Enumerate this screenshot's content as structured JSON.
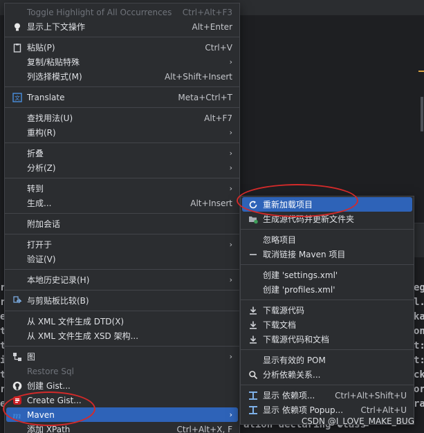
{
  "main_menu": {
    "items": [
      {
        "label": "Toggle Highlight of All Occurrences",
        "shortcut": "Ctrl+Alt+F3",
        "icon": "none",
        "disabled": true
      },
      {
        "label": "显示上下文操作",
        "shortcut": "Alt+Enter",
        "icon": "bulb-icon"
      },
      {
        "sep": true
      },
      {
        "label": "粘贴(P)",
        "shortcut": "Ctrl+V",
        "icon": "clipboard-icon"
      },
      {
        "label": "复制/粘贴特殊",
        "submenu": true
      },
      {
        "label": "列选择模式(M)",
        "shortcut": "Alt+Shift+Insert"
      },
      {
        "sep": true
      },
      {
        "label": "Translate",
        "shortcut": "Meta+Ctrl+T",
        "icon": "translate-icon"
      },
      {
        "sep": true
      },
      {
        "label": "查找用法(U)",
        "shortcut": "Alt+F7"
      },
      {
        "label": "重构(R)",
        "submenu": true
      },
      {
        "sep": true
      },
      {
        "label": "折叠",
        "submenu": true
      },
      {
        "label": "分析(Z)",
        "submenu": true
      },
      {
        "sep": true
      },
      {
        "label": "转到",
        "submenu": true
      },
      {
        "label": "生成...",
        "shortcut": "Alt+Insert"
      },
      {
        "sep": true
      },
      {
        "label": "附加会话"
      },
      {
        "sep": true
      },
      {
        "label": "打开于",
        "submenu": true
      },
      {
        "label": "验证(V)"
      },
      {
        "sep": true
      },
      {
        "label": "本地历史记录(H)",
        "submenu": true
      },
      {
        "sep": true
      },
      {
        "label": "与剪贴板比较(B)",
        "icon": "compare-icon"
      },
      {
        "sep": true
      },
      {
        "label": "从 XML 文件生成 DTD(X)"
      },
      {
        "label": "从 XML 文件生成 XSD 架构..."
      },
      {
        "sep": true
      },
      {
        "label": "图",
        "submenu": true,
        "icon": "diagram-icon"
      },
      {
        "label": "Restore Sql",
        "disabled": true
      },
      {
        "label": "创建 Gist...",
        "icon": "github-icon"
      },
      {
        "label": "Create Gist...",
        "icon": "gitee-icon"
      },
      {
        "label": "Maven",
        "submenu": true,
        "icon": "maven-icon",
        "selected": true
      },
      {
        "label": "添加 XPath",
        "shortcut": "Ctrl+Alt+X, F"
      }
    ]
  },
  "maven_menu": {
    "items": [
      {
        "label": "重新加载项目",
        "icon": "reload-icon",
        "selected": true
      },
      {
        "label": "生成源代码并更新文件夹",
        "icon": "folder-refresh-icon"
      },
      {
        "sep": true
      },
      {
        "label": "忽略项目"
      },
      {
        "label": "取消链接 Maven 项目",
        "icon": "minus-icon"
      },
      {
        "sep": true
      },
      {
        "label": "创建 'settings.xml'"
      },
      {
        "label": "创建 'profiles.xml'"
      },
      {
        "sep": true
      },
      {
        "label": "下载源代码",
        "icon": "download-icon"
      },
      {
        "label": "下载文档",
        "icon": "download-icon"
      },
      {
        "label": "下载源代码和文档",
        "icon": "download-icon"
      },
      {
        "sep": true
      },
      {
        "label": "显示有效的 POM"
      },
      {
        "label": "分析依赖关系...",
        "icon": "search-icon"
      },
      {
        "sep": true
      },
      {
        "label": "显示 依赖项...",
        "shortcut": "Ctrl+Alt+Shift+U",
        "icon": "dependency-icon"
      },
      {
        "label": "显示 依赖项 Popup...",
        "shortcut": "Ctrl+Alt+U",
        "icon": "dependency-icon"
      }
    ]
  },
  "background_code": {
    "line1": "ation declaring class",
    "right_fragments": [
      "eg",
      "l.",
      "ka",
      "on",
      "t:",
      "t:",
      "ck",
      "or",
      "ra"
    ],
    "left_fragments": [
      "r",
      "r",
      "e",
      "t",
      "t",
      "i",
      "t",
      "r",
      "e"
    ]
  },
  "watermark": "CSDN @I_LOVE_MAKE_BUG",
  "colors": {
    "menu_bg": "#2b2d30",
    "selection": "#2e63b8",
    "annotation": "#d42a2a"
  }
}
